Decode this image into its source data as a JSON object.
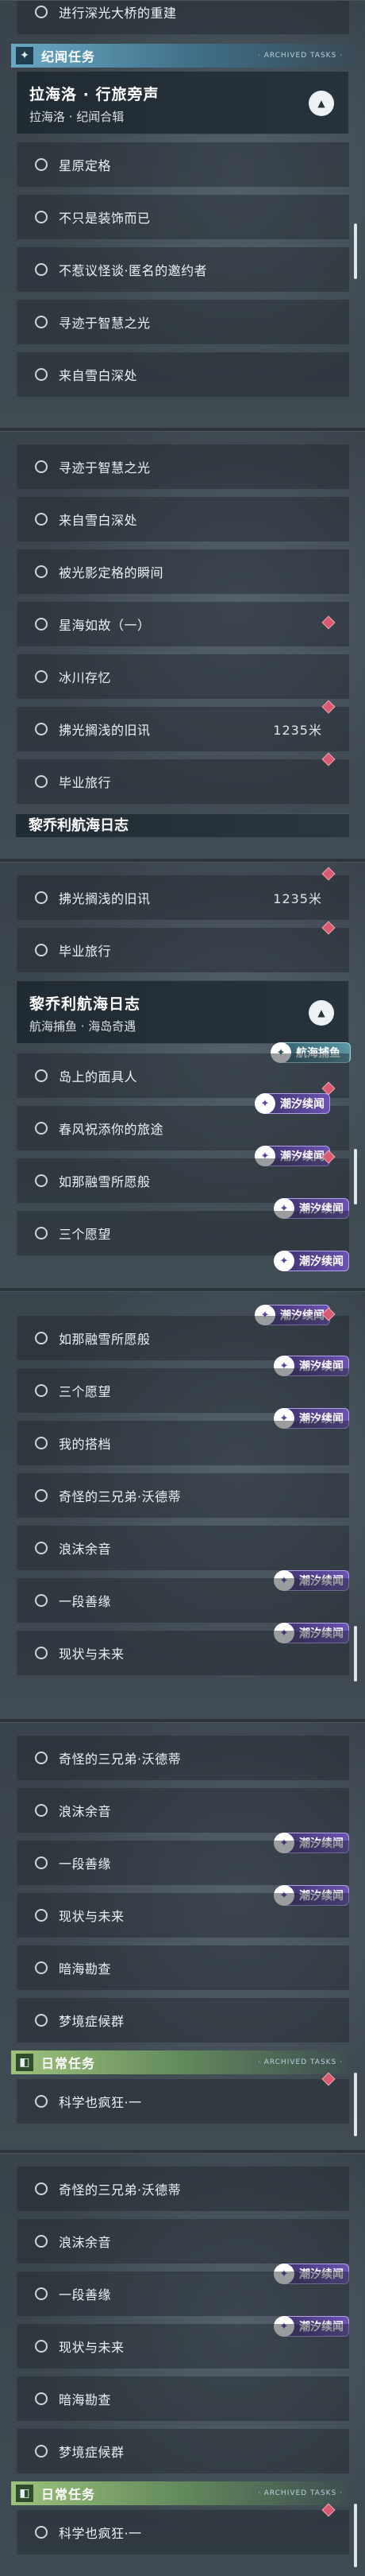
{
  "labels": {
    "bridge": "进行深光大桥的重建",
    "calibration": "星原定格",
    "not_decoration": "不只是装饰而已",
    "strange_invite": "不惹议怪谈·匿名的邀约者",
    "wisdom_light": "寻迹于智慧之光",
    "snow_depth": "来自雪白深处",
    "frozen_moment": "被光影定格的瞬间",
    "star_sea": "星海如故（一）",
    "ice_memory": "冰川存忆",
    "old_news": "拂光搁浅的旧讯",
    "graduation": "毕业旅行",
    "islander": "岛上的面具人",
    "spring_wind": "春风祝添你的旅途",
    "like_snow": "如那融雪所愿般",
    "three_wishes": "三个愿望",
    "my_tale": "我的搭档",
    "three_brothers": "奇怪的三兄弟·沃德蒂",
    "wave_foam": "浪沫余音",
    "good_deed": "一段善缘",
    "present_future": "现状与未来",
    "hidden_watch": "暗海勘查",
    "dream_chase": "梦境症候群",
    "science_crazy": "科学也疯狂·一"
  },
  "distance": "1235米",
  "sections": {
    "legend": "纪闻任务",
    "daily": "日常任务",
    "tag": "· ARCHIVED TASKS ·"
  },
  "groups": {
    "lahailuo_title": "拉海洛 · 行旅旁声",
    "lahailuo_sub": "拉海洛 · 纪闻合辑",
    "liqiaoli_title": "黎乔利航海日志",
    "liqiaoli_sub": "航海捕鱼 · 海岛奇遇"
  },
  "badges": {
    "tide": "潮汐续闻",
    "fishing": "航海捕鱼"
  },
  "icons": {
    "circle": "radio-circle-icon",
    "diamond": "red-diamond-marker-icon",
    "chevron": "chevron-up-icon",
    "tide_badge": "tide-story-icon",
    "fishing_badge": "fishing-icon",
    "section_legend": "star-sparkle-icon",
    "section_daily": "calendar-icon"
  },
  "colors": {
    "diamond": "#d75a71",
    "tide_badge": "#6b53b0",
    "legend_bar": "#69a8c4",
    "daily_bar": "#9cc27b"
  }
}
